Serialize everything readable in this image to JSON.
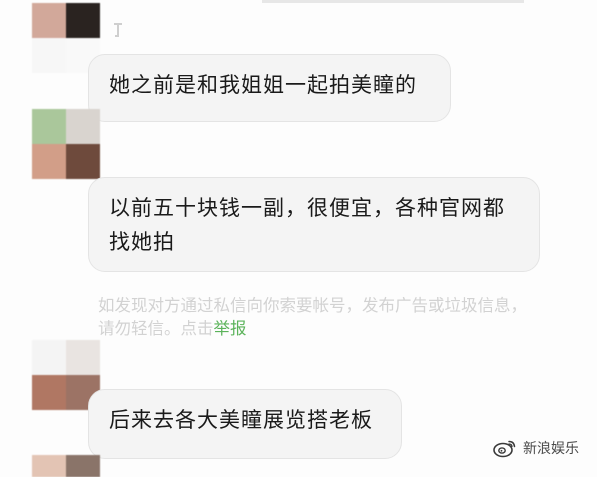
{
  "messages": [
    {
      "text": "她之前是和我姐姐一起拍美瞳的"
    },
    {
      "text": "以前五十块钱一副，很便宜，各种官网都找她拍"
    },
    {
      "text": "后来去各大美瞳展览搭老板"
    }
  ],
  "warning": {
    "text": "如发现对方通过私信向你索要帐号，发布广告或垃圾信息，请勿轻信。点击",
    "link": "举报"
  },
  "watermark": {
    "label": "新浪娱乐",
    "icon": "weibo-logo-icon"
  },
  "avatars": [
    {
      "name": "avatar-1",
      "colors": [
        "#d2a89a",
        "#2a2320",
        "#f7f7f7",
        "#f9f9f9"
      ]
    },
    {
      "name": "avatar-2",
      "colors": [
        "#aac79b",
        "#d9d4cf",
        "#d29e88",
        "#6e4a3c"
      ]
    },
    {
      "name": "avatar-3",
      "colors": [
        "#f4f4f4",
        "#e9e4e1",
        "#b07763",
        "#9c7365"
      ]
    },
    {
      "name": "avatar-4",
      "colors": [
        "#e3c4b4",
        "#8a7469",
        "#f8f8f8",
        "#f8f8f8"
      ]
    }
  ]
}
